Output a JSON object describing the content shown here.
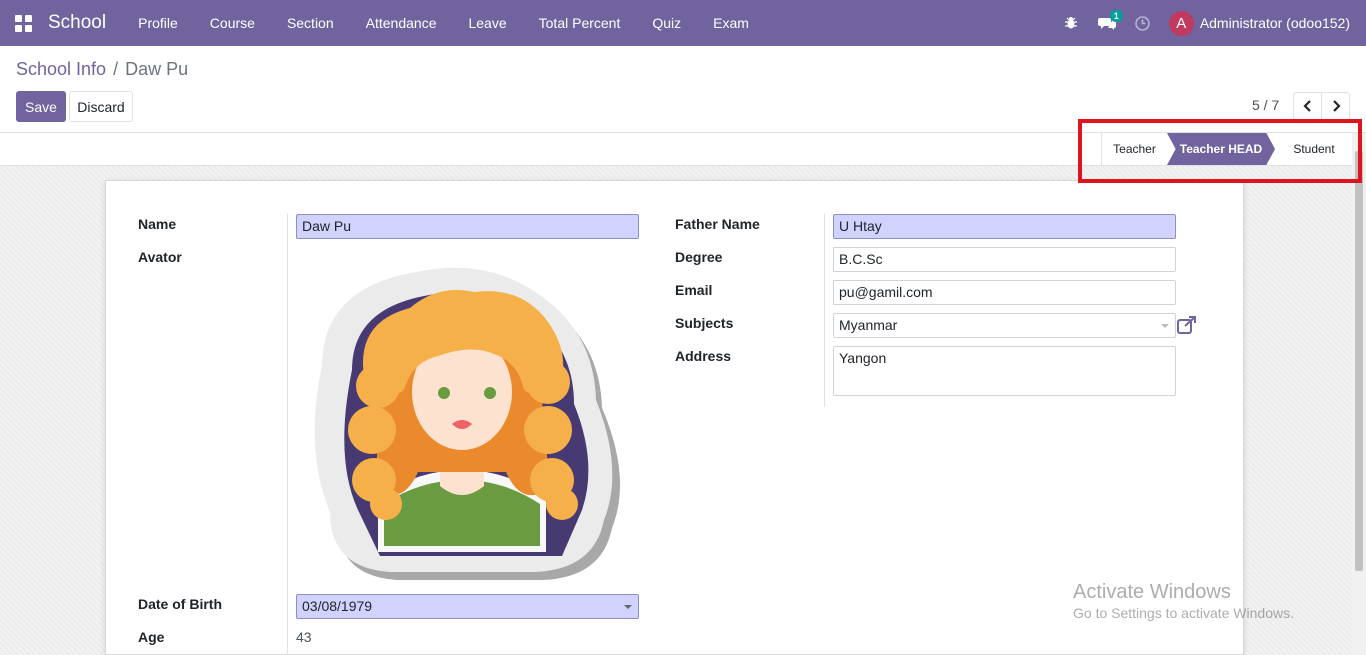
{
  "navbar": {
    "brand": "School",
    "menu": [
      "Profile",
      "Course",
      "Section",
      "Attendance",
      "Leave",
      "Total Percent",
      "Quiz",
      "Exam"
    ],
    "messages_count": "1",
    "user_initial": "A",
    "user_name": "Administrator (odoo152)"
  },
  "breadcrumb": {
    "parent": "School Info",
    "separator": "/",
    "current": "Daw Pu"
  },
  "actions": {
    "save_label": "Save",
    "discard_label": "Discard"
  },
  "pager": {
    "value": "5 / 7"
  },
  "statusbar": {
    "stages": [
      "Teacher",
      "Teacher HEAD",
      "Student"
    ],
    "active": "Teacher HEAD"
  },
  "form": {
    "name_label": "Name",
    "name_value": "Daw Pu",
    "avatar_label": "Avator",
    "dob_label": "Date of Birth",
    "dob_value": "03/08/1979",
    "age_label": "Age",
    "age_value": "43",
    "father_label": "Father Name",
    "father_value": "U Htay",
    "degree_label": "Degree",
    "degree_value": "B.C.Sc",
    "email_label": "Email",
    "email_value": "pu@gamil.com",
    "subjects_label": "Subjects",
    "subjects_value": "Myanmar",
    "address_label": "Address",
    "address_value": "Yangon"
  },
  "watermark": {
    "line1": "Activate Windows",
    "line2": "Go to Settings to activate Windows."
  },
  "colors": {
    "brand": "#71639e",
    "required_field": "#d2d2ff",
    "highlight": "#e0141e"
  }
}
